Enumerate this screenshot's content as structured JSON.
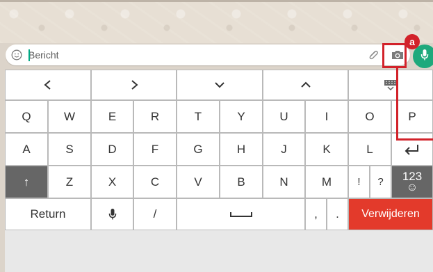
{
  "composer": {
    "placeholder": "Bericht"
  },
  "annotation": {
    "badge": "a"
  },
  "keyboard": {
    "nav_row": [
      "‹",
      "›",
      "⌄",
      "⌃",
      "▦"
    ],
    "row1": [
      "Q",
      "W",
      "E",
      "R",
      "T",
      "Y",
      "U",
      "I",
      "O",
      "P"
    ],
    "row2": [
      "A",
      "S",
      "D",
      "F",
      "G",
      "H",
      "J",
      "K",
      "L",
      "↵"
    ],
    "row3": [
      "↑",
      "Z",
      "X",
      "C",
      "V",
      "B",
      "N",
      "M",
      "!",
      "?"
    ],
    "numeric_key": "123",
    "numeric_key_sub": "☺",
    "return_label": "Return",
    "slash_label": "/",
    "comma_label": ",",
    "period_label": ".",
    "delete_label": "Verwijderen"
  },
  "colors": {
    "accent_green": "#1ea97c",
    "annotation_red": "#d2222a",
    "delete_red": "#e33a2b",
    "shift_gray": "#666666"
  }
}
